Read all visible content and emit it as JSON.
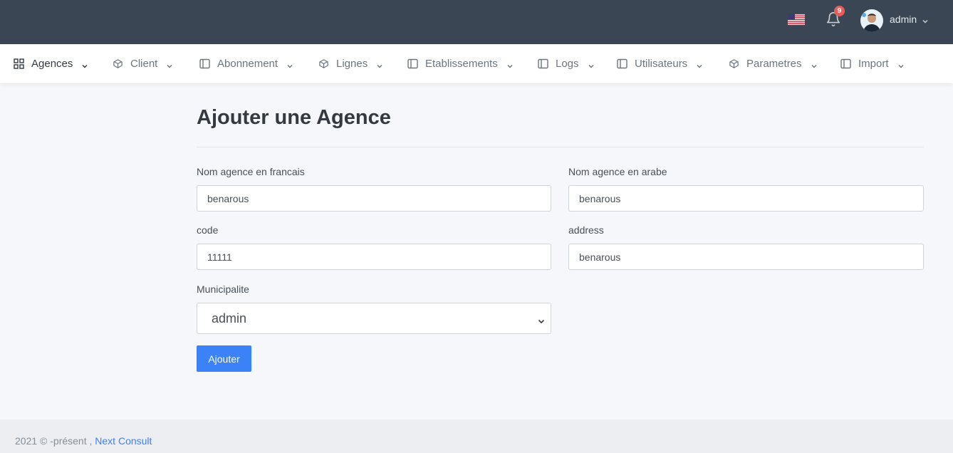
{
  "topbar": {
    "flag_icon": "us-flag-icon",
    "notifications_count": "9",
    "user_name": "admin"
  },
  "nav": {
    "items": [
      {
        "label": "Agences",
        "icon": "grid-icon"
      },
      {
        "label": "Client",
        "icon": "box-icon"
      },
      {
        "label": "Abonnement",
        "icon": "sidebar-icon"
      },
      {
        "label": "Lignes",
        "icon": "box-icon"
      },
      {
        "label": "Etablissements",
        "icon": "sidebar-icon"
      },
      {
        "label": "Logs",
        "icon": "sidebar-icon"
      },
      {
        "label": "Utilisateurs",
        "icon": "sidebar-icon"
      },
      {
        "label": "Parametres",
        "icon": "box-icon"
      },
      {
        "label": "Import",
        "icon": "sidebar-icon"
      }
    ]
  },
  "page": {
    "title": "Ajouter une Agence"
  },
  "form": {
    "nom_fr_label": "Nom agence en francais",
    "nom_fr_value": "benarous",
    "nom_ar_label": "Nom agence en arabe",
    "nom_ar_value": "benarous",
    "code_label": "code",
    "code_value": "11111",
    "address_label": "address",
    "address_value": "benarous",
    "municipalite_label": "Municipalite",
    "municipalite_value": "admin",
    "submit_label": "Ajouter"
  },
  "footer": {
    "text": "2021 © -présent , ",
    "link": "Next Consult"
  },
  "colors": {
    "topbar": "#3a4653",
    "accent": "#3b82f6",
    "badge": "#e85c5c"
  }
}
